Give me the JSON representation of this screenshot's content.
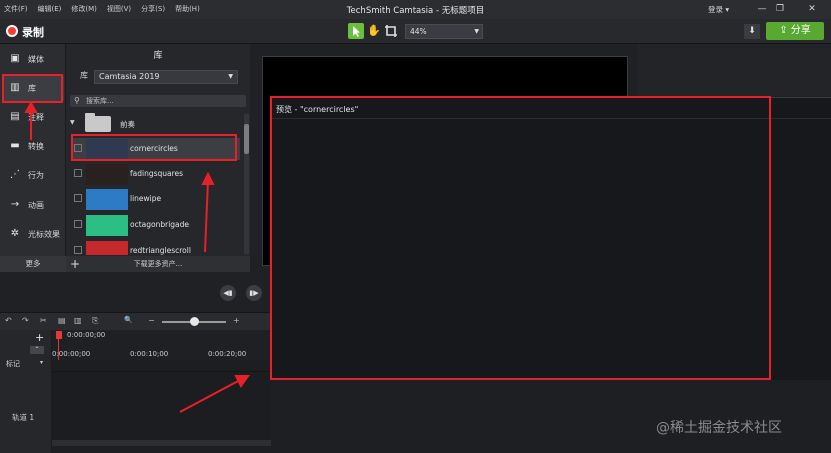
{
  "window": {
    "menu": [
      "文件(F)",
      "编辑(E)",
      "修改(M)",
      "视图(V)",
      "分享(S)",
      "帮助(H)"
    ],
    "title": "TechSmith Camtasia - 无标题项目",
    "login": "登录 ▾",
    "minimize": "—",
    "maximize": "❐",
    "close": "✕"
  },
  "toolbar": {
    "record_label": "录制",
    "zoom_value": "44%",
    "share_label": "分享",
    "share_icon": "⇪",
    "download_icon": "⬇"
  },
  "sidebar": {
    "items": [
      {
        "icon": "▣",
        "label": "媒体"
      },
      {
        "icon": "▥",
        "label": "库"
      },
      {
        "icon": "▤",
        "label": "注释"
      },
      {
        "icon": "▬",
        "label": "转换"
      },
      {
        "icon": "⋰",
        "label": "行为"
      },
      {
        "icon": "→",
        "label": "动画"
      },
      {
        "icon": "✲",
        "label": "光标效果"
      }
    ],
    "more_label": "更多"
  },
  "library": {
    "title": "库",
    "library_prefix": "库",
    "selected_library": "Camtasia 2019",
    "search_placeholder": "搜索库...",
    "folder_label": "前奏",
    "assets": [
      {
        "label": "cornercircles",
        "thumb_color": "#2f3a52"
      },
      {
        "label": "fadingsquares",
        "thumb_color": "#2a2020"
      },
      {
        "label": "linewipe",
        "thumb_color": "#2d7bc4"
      },
      {
        "label": "octagonbrigade",
        "thumb_color": "#2bbf84"
      },
      {
        "label": "redtrianglescroll",
        "thumb_color": "#c7282b"
      }
    ],
    "add_icon": "+",
    "download_more": "下载更多资产..."
  },
  "preview": {
    "title": "预览 - \"cornercircles\""
  },
  "playback": {
    "prev_icon": "◀▮",
    "play_icon": "▮▶"
  },
  "timeline": {
    "icons": [
      "↶",
      "↷",
      "✂",
      "▤",
      "▥",
      "⎘"
    ],
    "zoom_icon": "🔍",
    "zoom_minus": "−",
    "zoom_plus": "+",
    "zoom_level": 0.5,
    "playhead_time": "0:00:00;00",
    "ruler_times": [
      "0:00:00;00",
      "0:00:10;00",
      "0:00:20;00"
    ],
    "add_track": "+",
    "collapse": "⌃",
    "marker_label": "标记",
    "marker_caret": "▾",
    "track_label": "轨道 1"
  },
  "watermark": "@稀土掘金技术社区",
  "colors": {
    "accent_green": "#59a832",
    "record_red": "#ff3b30",
    "annotation_red": "#e8202a"
  }
}
